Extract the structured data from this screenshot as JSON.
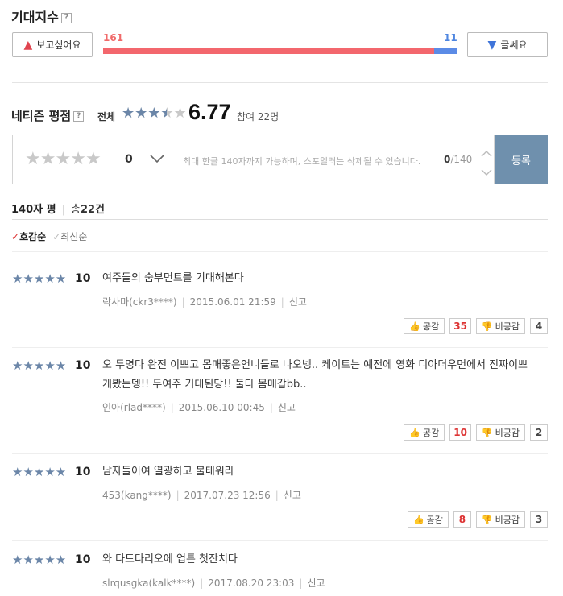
{
  "expect": {
    "title": "기대지수",
    "help": "?",
    "want_label": "보고싶어요",
    "meh_label": "글쎄요",
    "want_count": "161",
    "meh_count": "11",
    "want_ratio": 0.936
  },
  "netizen": {
    "title": "네티즌 평점",
    "help": "?",
    "scope": "전체",
    "score": "6.77",
    "participants": "참여 22명",
    "score_fraction": 0.677
  },
  "rate_input": {
    "current": "0",
    "placeholder": "최대 한글 140자까지 가능하며, 스포일러는 삭제될 수 있습니다.",
    "counter_current": "0",
    "counter_max": "/140",
    "submit": "등록"
  },
  "list_header": {
    "label": "140자 평",
    "total_prefix": "총",
    "total": "22건"
  },
  "sort": {
    "options": [
      "호감순",
      "최신순"
    ],
    "active": 0
  },
  "vote_labels": {
    "like": "공감",
    "dislike": "비공감"
  },
  "reviews": [
    {
      "score": "10",
      "text": "여주들의 숨부먼트를 기대해본다",
      "author": "락사마(ckr3****)",
      "date": "2015.06.01 21:59",
      "report": "신고",
      "likes": "35",
      "dislikes": "4"
    },
    {
      "score": "10",
      "text": "오 두명다 완전 이쁘고 몸매좋은언니들로 나오넹.. 케이트는 예전에 영화 디아더우먼에서 진짜이쁘게봤는뎅!! 두여주 기대된당!! 둘다 몸매갑bb..",
      "author": "인아(rlad****)",
      "date": "2015.06.10 00:45",
      "report": "신고",
      "likes": "10",
      "dislikes": "2"
    },
    {
      "score": "10",
      "text": "남자들이여 열광하고 불태워라",
      "author": "453(kang****)",
      "date": "2017.07.23 12:56",
      "report": "신고",
      "likes": "8",
      "dislikes": "3"
    },
    {
      "score": "10",
      "text": "와 다드다리오에 업튼 첫잔치다",
      "author": "slrqusgka(kalk****)",
      "date": "2017.08.20 23:03",
      "report": "신고"
    }
  ]
}
